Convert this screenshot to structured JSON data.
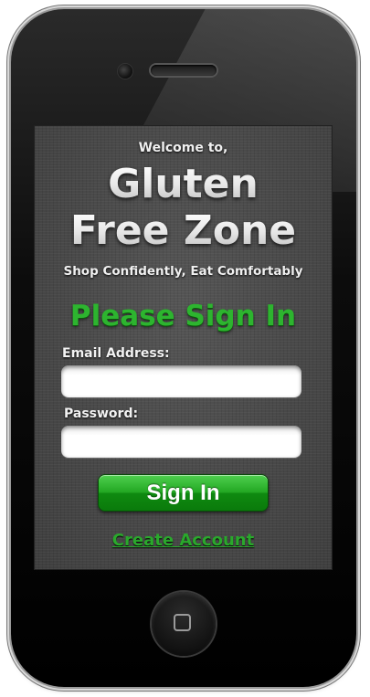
{
  "screen": {
    "welcome": "Welcome to,",
    "title_line1": "Gluten",
    "title_line2": "Free Zone",
    "tagline": "Shop Confidently, Eat Comfortably",
    "heading": "Please Sign In",
    "email_label": "Email Address:",
    "email_value": "",
    "password_label": "Password:",
    "password_value": "",
    "signin_button": "Sign In",
    "create_account_link": "Create Account"
  },
  "colors": {
    "accent_green": "#2db42f",
    "button_green": "#23a823",
    "screen_background": "#4a4a4a",
    "phone_body": "#000000"
  },
  "icons": {
    "home_button": "home-button-icon",
    "camera": "front-camera-icon",
    "speaker": "speaker-grille-icon"
  }
}
